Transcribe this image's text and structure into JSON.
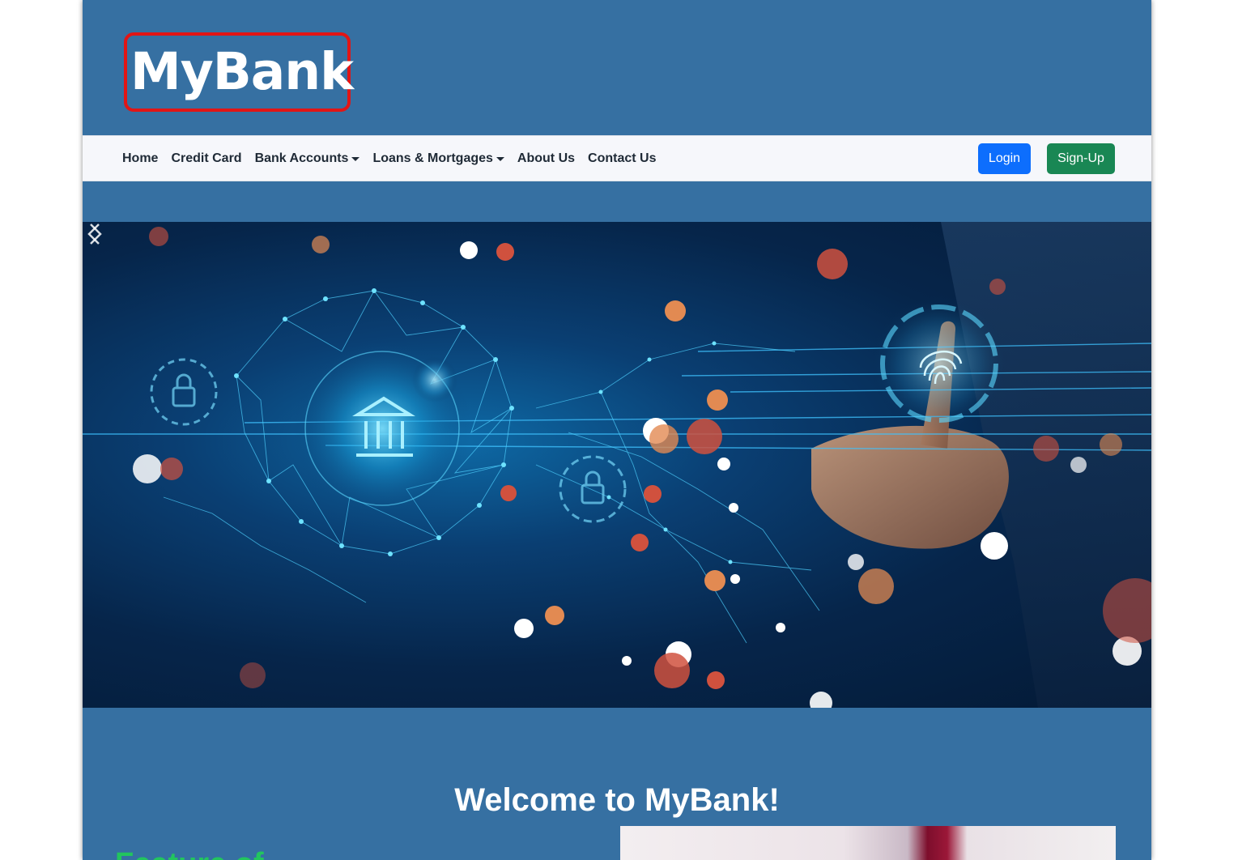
{
  "brand": {
    "logo_text": "MyBank",
    "border_color": "#e21515",
    "background_color": "#3670a2"
  },
  "nav": {
    "items": [
      {
        "label": "Home",
        "dropdown": false
      },
      {
        "label": "Credit Card",
        "dropdown": false
      },
      {
        "label": "Bank Accounts",
        "dropdown": true
      },
      {
        "label": "Loans & Mortgages",
        "dropdown": true
      },
      {
        "label": "About Us",
        "dropdown": false
      },
      {
        "label": "Contact Us",
        "dropdown": false
      }
    ],
    "login_label": "Login",
    "signup_label": "Sign-Up",
    "login_color": "#0d6efd",
    "signup_color": "#198754"
  },
  "carousel": {
    "image_description_icon": "digital-banking-network-image",
    "prev_icon": "chevron-left-icon",
    "next_icon": "chevron-right-icon"
  },
  "main": {
    "welcome_title": "Welcome to MyBank!",
    "feature_heading": "Feature of"
  }
}
